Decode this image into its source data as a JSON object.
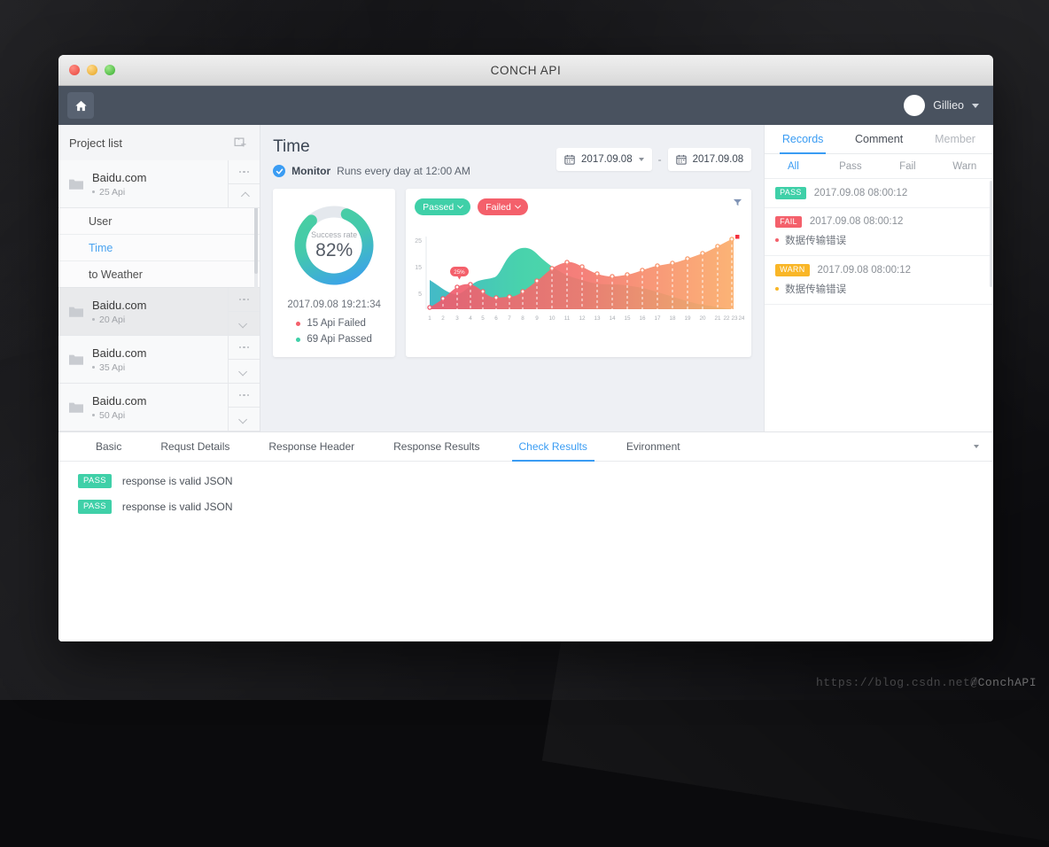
{
  "window": {
    "title": "CONCH API",
    "traffic_lights": [
      "close",
      "minimize",
      "maximize"
    ]
  },
  "header": {
    "home_icon": "home-icon",
    "user_name": "Gillieo",
    "caret_icon": "chevron-down-icon"
  },
  "sidebar": {
    "title": "Project list",
    "add_icon": "new-folder-icon",
    "projects": [
      {
        "name": "Baidu.com",
        "api_count": "25 Api",
        "expanded": true,
        "shaded": false,
        "children": [
          {
            "label": "User",
            "active": false
          },
          {
            "label": "Time",
            "active": true
          },
          {
            "label": "to Weather",
            "active": false
          }
        ]
      },
      {
        "name": "Baidu.com",
        "api_count": "20 Api",
        "expanded": false,
        "shaded": true,
        "children": []
      },
      {
        "name": "Baidu.com",
        "api_count": "35 Api",
        "expanded": false,
        "shaded": false,
        "children": []
      },
      {
        "name": "Baidu.com",
        "api_count": "50 Api",
        "expanded": false,
        "shaded": false,
        "children": []
      }
    ]
  },
  "main": {
    "title": "Time",
    "monitor_label": "Monitor",
    "monitor_desc": "Runs every day at 12:00 AM",
    "check_icon": "check-circle-icon",
    "date_from": "2017.09.08",
    "date_to": "2017.09.08",
    "date_separator": "-",
    "calendar_icon": "calendar-icon"
  },
  "donut": {
    "center_label": "Success rate",
    "center_value": "82%",
    "timestamp": "2017.09.08 19:21:34",
    "legend": [
      {
        "label": "15 Api Failed",
        "color": "#f4606b"
      },
      {
        "label": "69 Api Passed",
        "color": "#3fd0a8"
      }
    ],
    "success_pct": 82,
    "gradient_start": "#3fd0a8",
    "gradient_end": "#3a9cf3"
  },
  "chart_card": {
    "pills": [
      {
        "label": "Passed",
        "color": "#3fd0a8"
      },
      {
        "label": "Failed",
        "color": "#f4606b"
      }
    ],
    "filter_icon": "funnel-icon",
    "tooltip": "25%"
  },
  "chart_data": {
    "type": "area",
    "title": "",
    "xlabel": "",
    "ylabel": "",
    "x": [
      1,
      2,
      3,
      4,
      5,
      6,
      7,
      8,
      9,
      10,
      11,
      12,
      13,
      14,
      15,
      16,
      17,
      18,
      19,
      20,
      21,
      22,
      23,
      24
    ],
    "categories": [
      "1",
      "2",
      "3",
      "4",
      "5",
      "6",
      "7",
      "8",
      "9",
      "10",
      "11",
      "12",
      "13",
      "14",
      "15",
      "16",
      "17",
      "18",
      "19",
      "20",
      "21",
      "22",
      "23",
      "24"
    ],
    "yticks": [
      5,
      15,
      25
    ],
    "ylim": [
      0,
      30
    ],
    "grid": false,
    "legend_position": "top-left",
    "annotations": [
      {
        "x": 5,
        "y": 11,
        "text": "25%"
      }
    ],
    "series": [
      {
        "name": "Passed",
        "color": "#3fd0a8",
        "values": [
          11,
          7,
          6,
          8,
          9,
          9,
          15,
          20,
          17,
          15,
          14,
          12,
          9,
          8,
          8,
          8,
          8,
          8,
          7,
          7,
          6,
          5,
          4,
          3
        ]
      },
      {
        "name": "Failed",
        "color": "#f4606b",
        "values": [
          1,
          3,
          6,
          9,
          10,
          8,
          6,
          6,
          9,
          14,
          16,
          14,
          12,
          11,
          11,
          13,
          15,
          15,
          16,
          18,
          19,
          21,
          25,
          27
        ]
      }
    ]
  },
  "records": {
    "tabs": [
      {
        "label": "Records",
        "state": "active"
      },
      {
        "label": "Comment",
        "state": "normal"
      },
      {
        "label": "Member",
        "state": "muted"
      }
    ],
    "filters": [
      {
        "label": "All",
        "active": true
      },
      {
        "label": "Pass",
        "active": false
      },
      {
        "label": "Fail",
        "active": false
      },
      {
        "label": "Warn",
        "active": false
      }
    ],
    "rows": [
      {
        "status": "PASS",
        "status_class": "pass",
        "date": "2017.09.08  08:00:12",
        "message": "",
        "dot_color": ""
      },
      {
        "status": "FAIL",
        "status_class": "fail",
        "date": "2017.09.08  08:00:12",
        "message": "数据传输错误",
        "dot_color": "#f4606b"
      },
      {
        "status": "WARN",
        "status_class": "warn",
        "date": "2017.09.08  08:00:12",
        "message": "数据传输错误",
        "dot_color": "#f9b627"
      }
    ]
  },
  "bottom": {
    "tabs": [
      {
        "label": "Basic",
        "active": false
      },
      {
        "label": "Requst Details",
        "active": false
      },
      {
        "label": "Response Header",
        "active": false
      },
      {
        "label": "Response Results",
        "active": false
      },
      {
        "label": "Check Results",
        "active": true
      },
      {
        "label": "Evironment",
        "active": false
      }
    ],
    "overflow_icon": "chevron-down-icon",
    "checks": [
      {
        "status": "PASS",
        "text": "response is valid JSON"
      },
      {
        "status": "PASS",
        "text": "response is valid JSON"
      }
    ]
  },
  "watermark": {
    "line1": "https://blog.csdn.net/ConchAPI",
    "line2": "@ConchAPI"
  }
}
